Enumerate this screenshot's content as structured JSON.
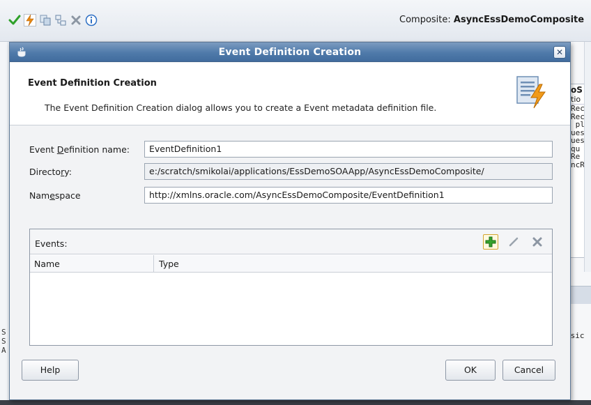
{
  "ide": {
    "composite_prefix": "Composite:",
    "composite_name": "AsyncEssDemoComposite",
    "right_panel_header": "oS",
    "right_panel_sub": "tio",
    "right_panel_lines": "Rec\nRec\n pl\nues\nues\nqu\nRe\nncR",
    "right_bottom_text": "usic\nS",
    "left_bottom_text": "S\nS\nA"
  },
  "dialog": {
    "title": "Event Definition Creation",
    "header_title": "Event Definition Creation",
    "header_description": "The Event Definition Creation dialog allows you to create a Event metadata definition file.",
    "fields": {
      "name_label_pre": "Event ",
      "name_label_mn": "D",
      "name_label_post": "efinition name:",
      "name_value": "EventDefinition1",
      "dir_label_pre": "Directo",
      "dir_label_mn": "r",
      "dir_label_post": "y:",
      "dir_value": "e:/scratch/smikolai/applications/EssDemoSOAApp/AsyncEssDemoComposite/",
      "ns_label_pre": "Nam",
      "ns_label_mn": "e",
      "ns_label_post": "space",
      "ns_value": "http://xmlns.oracle.com/AsyncEssDemoComposite/EventDefinition1"
    },
    "events": {
      "label": "Events:",
      "columns": [
        "Name",
        "Type"
      ]
    },
    "buttons": {
      "help": "Help",
      "ok": "OK",
      "cancel": "Cancel"
    }
  },
  "colors": {
    "titlebar": "#4f7aaa",
    "accent_green": "#2fa12a",
    "accent_orange": "#e88a13"
  }
}
